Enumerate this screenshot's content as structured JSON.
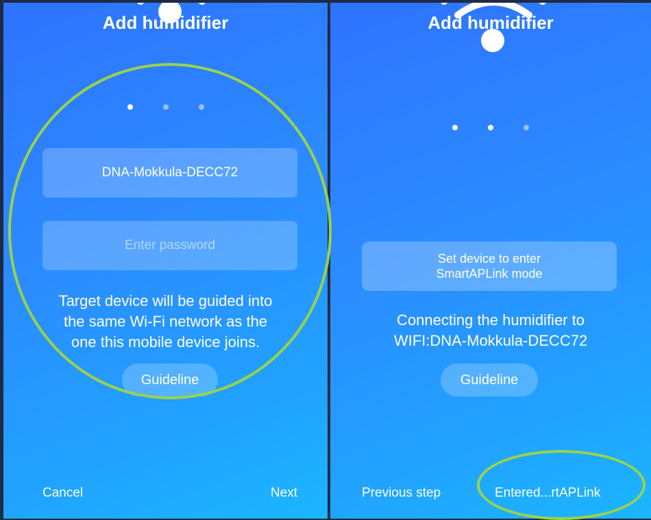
{
  "left_screen": {
    "title": "Add humidifier",
    "wifi_name": "DNA-Mokkula-DECC72",
    "password_placeholder": "Enter password",
    "info_lines": [
      "Target device will be guided into",
      "the same Wi-Fi network as the",
      "one this mobile device joins."
    ],
    "guideline_label": "Guideline",
    "cancel_label": "Cancel",
    "next_label": "Next",
    "step_index": 1,
    "step_count": 3
  },
  "right_screen": {
    "title": "Add humidifier",
    "mode_lines": [
      "Set device to enter",
      "SmartAPLink mode"
    ],
    "status_lines": [
      "Connecting the humidifier to",
      "WIFI:DNA-Mokkula-DECC72"
    ],
    "guideline_label": "Guideline",
    "previous_label": "Previous step",
    "entered_label": "Entered...rtAPLink",
    "step_index": 2,
    "step_count": 3
  },
  "colors": {
    "highlight": "#9ad24a",
    "gradient_top": "#2f73ff",
    "gradient_bottom": "#1cb6ff"
  },
  "icons": [
    "wifi-icon"
  ]
}
